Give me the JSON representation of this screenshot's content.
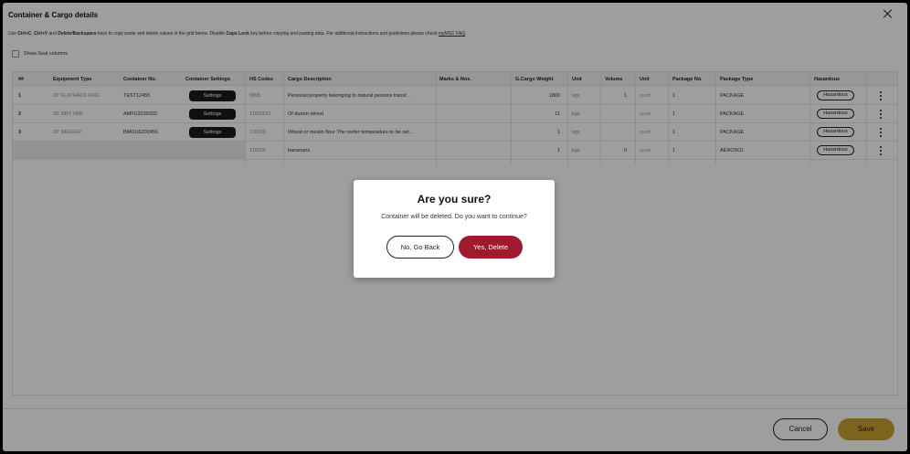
{
  "window": {
    "title": "Container & Cargo details",
    "hint": {
      "p1": "Use ",
      "k1": "Ctrl+C",
      "p2": ", ",
      "k2": "Ctrl+V",
      "p3": " and ",
      "k3": "Delete/Backspace",
      "p4": " keys to copy paste and delete values in the grid below. Disable ",
      "k4": "Caps Lock",
      "p5": " key before copying and pasting data. For additional instructions and guidelines please check ",
      "link": "myMSC FAQ",
      "p6": "."
    },
    "show_seal_label": "Show Seal columns"
  },
  "grid": {
    "headers": [
      "##",
      "Equipment Type",
      "Container No.",
      "Container Settings",
      "HS Codes",
      "Cargo Description",
      "Marks & Nos.",
      "G.Cargo Weight",
      "Unit",
      "Volume",
      "Unit",
      "Package No.",
      "Package Type",
      "Hazardous"
    ],
    "rows": [
      {
        "num": "1",
        "equipment": "20' FLATRACK FIXE...",
        "container": "TEST12455",
        "settings": "Settings",
        "hs": "9905",
        "desc": "Personal property belonging to natural persons transf...",
        "marks": "",
        "weight": "1800",
        "wunit": "kgs",
        "volume": "1",
        "vunit": "cu.m",
        "pkgno": "1",
        "pkgtype": "PACKAGE",
        "hazardous": "Hazardous"
      },
      {
        "num": "2",
        "equipment": "20' DRY VAN",
        "container": "AMFU3239332",
        "settings": "Settings",
        "hs": "11010011",
        "desc": "Of durum wheat",
        "marks": "",
        "weight": "11",
        "wunit": "kgs",
        "volume": "",
        "vunit": "cu.m",
        "pkgno": "1",
        "pkgtype": "PACKAGE",
        "hazardous": "Hazardous"
      },
      {
        "num": "3",
        "equipment": "20' REEFER",
        "container": "BMOU6202456",
        "settings": "Settings",
        "hs": "110100",
        "desc": "Wheat or meslin flour The reefer temperature to be set...",
        "marks": "",
        "weight": "1",
        "wunit": "kgs",
        "volume": "",
        "vunit": "cu.m",
        "pkgno": "1",
        "pkgtype": "PACKAGE",
        "hazardous": "Hazardous"
      },
      {
        "hs": "110100",
        "desc": "bananans",
        "marks": "",
        "weight": "1",
        "wunit": "kgs",
        "volume": "0",
        "vunit": "cu.m",
        "pkgno": "1",
        "pkgtype": "AEROSOL",
        "hazardous": "Hazardous"
      }
    ]
  },
  "footer": {
    "cancel": "Cancel",
    "save": "Save"
  },
  "dialog": {
    "title": "Are you sure?",
    "message": "Container will be deleted. Do you want to continue?",
    "no_label": "No, Go Back",
    "yes_label": "Yes, Delete"
  }
}
